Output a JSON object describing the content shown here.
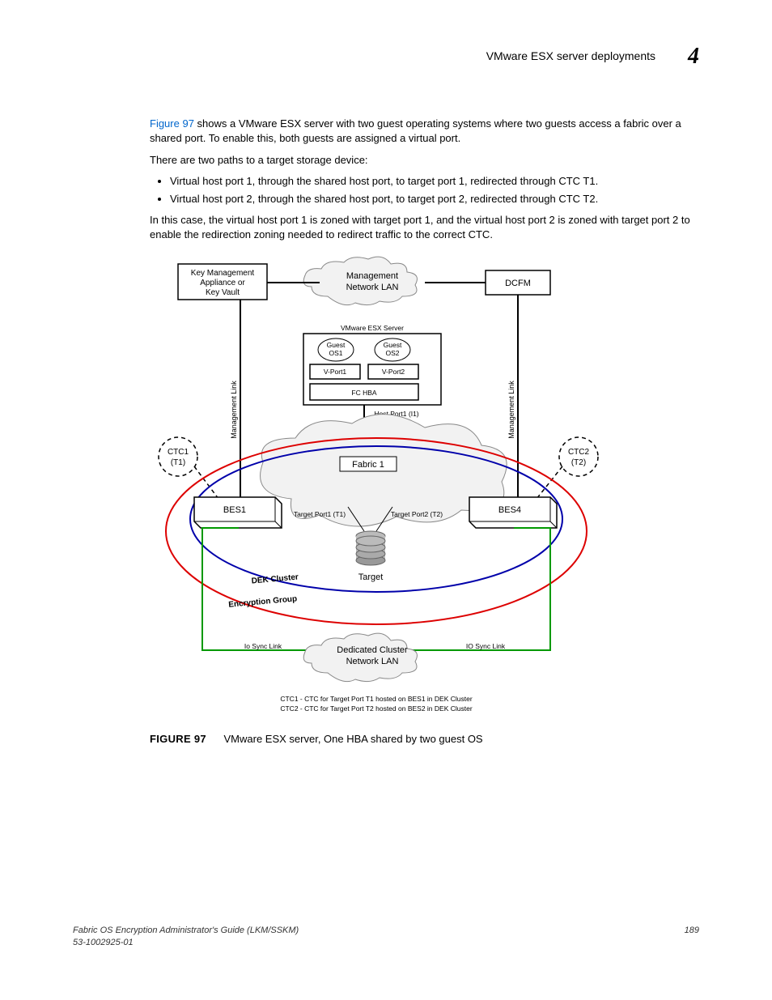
{
  "header": {
    "title": "VMware ESX server deployments",
    "chapter": "4"
  },
  "body": {
    "p1a": "Figure 97",
    "p1b": " shows a VMware ESX server with two guest operating systems where two guests access a fabric over a shared port. To enable this, both guests are assigned a virtual port.",
    "p2": "There are two paths to a target storage device:",
    "b1": "Virtual host port 1, through the shared host port, to target port 1, redirected through CTC T1.",
    "b2": "Virtual host port 2, through the shared host port, to target port 2, redirected through CTC T2.",
    "p3": "In this case, the virtual host port 1 is zoned with target port 1, and the virtual host port 2 is zoned with target port 2 to enable the redirection zoning needed to redirect traffic to the correct CTC."
  },
  "diagram": {
    "kma1": "Key Management",
    "kma2": "Appliance or",
    "kma3": "Key Vault",
    "mgmt1": "Management",
    "mgmt2": "Network LAN",
    "dcfm": "DCFM",
    "esx": "VMware ESX Server",
    "g1a": "Guest",
    "g1b": "OS1",
    "g2a": "Guest",
    "g2b": "OS2",
    "vp1": "V-Port1",
    "vp2": "V-Port2",
    "hba": "FC HBA",
    "hp": "Host Port1 (I1)",
    "ml": "Management Link",
    "ctc1a": "CTC1",
    "ctc1b": "(T1)",
    "ctc2a": "CTC2",
    "ctc2b": "(T2)",
    "fabric": "Fabric 1",
    "bes1": "BES1",
    "bes4": "BES4",
    "tp1": "Target Port1 (T1)",
    "tp2": "Target Port2 (T2)",
    "target": "Target",
    "dek": "DEK Cluster",
    "eg": "Encryption Group",
    "io1": "Io Sync Link",
    "io2": "IO Sync Link",
    "dc1": "Dedicated Cluster",
    "dc2": "Network LAN",
    "note1": "CTC1 - CTC for Target Port T1 hosted on BES1 in DEK Cluster",
    "note2": "CTC2 - CTC for Target Port T2 hosted on BES2 in DEK Cluster"
  },
  "figure": {
    "label": "FIGURE 97",
    "caption": "VMware ESX server, One HBA shared by two guest OS"
  },
  "footer": {
    "left1": "Fabric OS Encryption Administrator's Guide  (LKM/SSKM)",
    "left2": "53-1002925-01",
    "right": "189"
  }
}
